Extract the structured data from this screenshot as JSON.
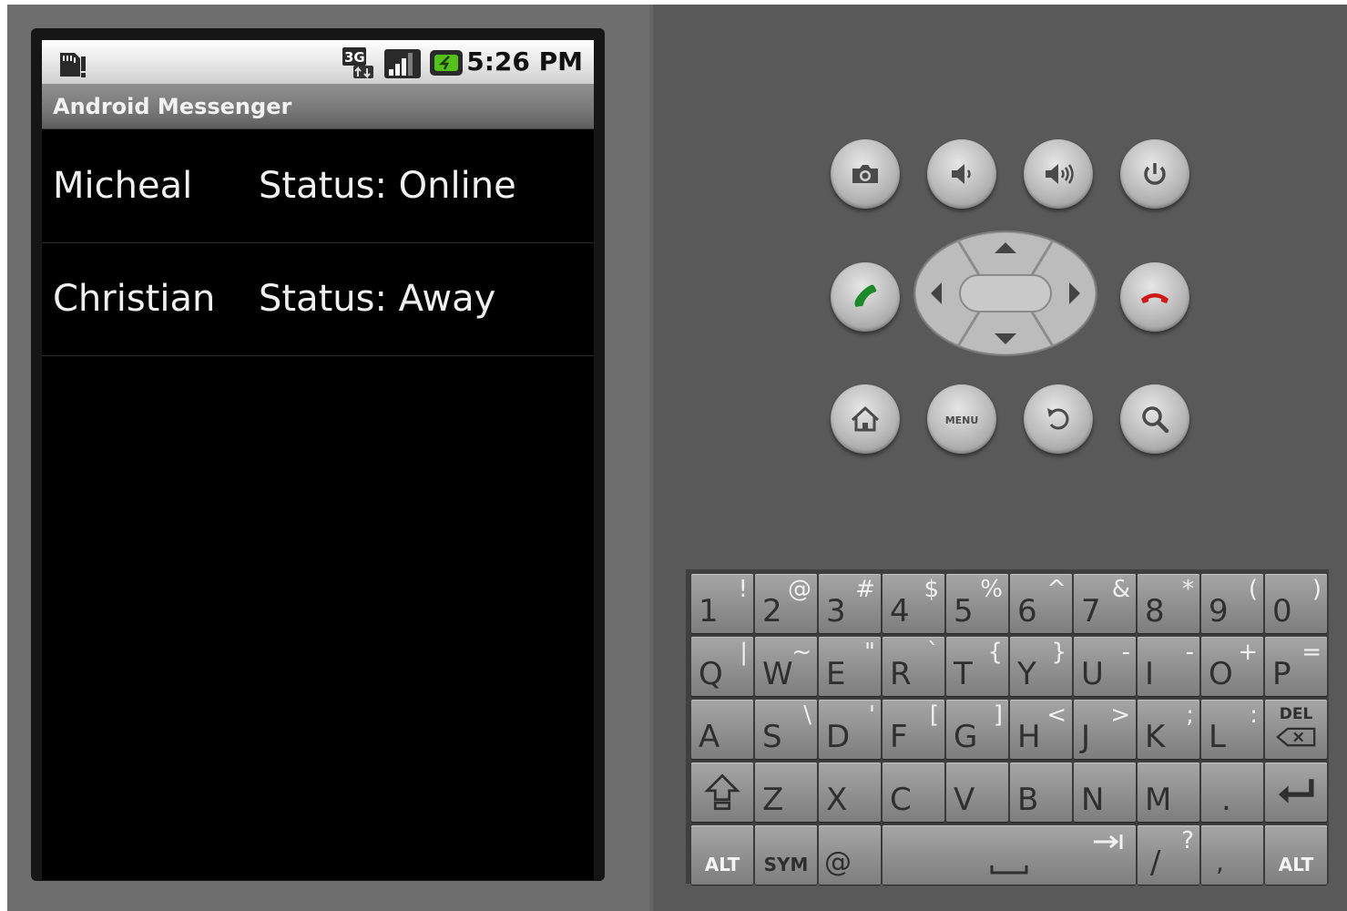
{
  "status_bar": {
    "time": "5:26 PM",
    "icons": [
      "sd-card-icon",
      "3g-icon",
      "signal-icon",
      "battery-charging-icon"
    ]
  },
  "app": {
    "title": "Android Messenger"
  },
  "contacts": [
    {
      "name": "Micheal",
      "status": "Status: Online"
    },
    {
      "name": "Christian",
      "status": "Status: Away"
    }
  ],
  "hardware_buttons": {
    "row1": [
      "camera-icon",
      "volume-down-icon",
      "volume-up-icon",
      "power-icon"
    ],
    "row2": [
      "call-icon",
      "dpad",
      "end-call-icon"
    ],
    "row3": [
      "home-icon",
      "menu-button",
      "back-icon",
      "search-icon"
    ],
    "menu_label": "MENU"
  },
  "keyboard": {
    "rows": [
      [
        [
          "1",
          "!"
        ],
        [
          "2",
          "@"
        ],
        [
          "3",
          "#"
        ],
        [
          "4",
          "$"
        ],
        [
          "5",
          "%"
        ],
        [
          "6",
          "^"
        ],
        [
          "7",
          "&"
        ],
        [
          "8",
          "*"
        ],
        [
          "9",
          "("
        ],
        [
          "0",
          ")"
        ]
      ],
      [
        [
          "Q",
          "|"
        ],
        [
          "W",
          "~"
        ],
        [
          "E",
          "\""
        ],
        [
          "R",
          "`"
        ],
        [
          "T",
          "{"
        ],
        [
          "Y",
          "}"
        ],
        [
          "U",
          "-"
        ],
        [
          "I",
          "-"
        ],
        [
          "O",
          "+"
        ],
        [
          "P",
          "="
        ]
      ],
      [
        [
          "A",
          ""
        ],
        [
          "S",
          "\\"
        ],
        [
          "D",
          "'"
        ],
        [
          "F",
          "["
        ],
        [
          "G",
          "]"
        ],
        [
          "H",
          "<"
        ],
        [
          "J",
          ">"
        ],
        [
          "K",
          ";"
        ],
        [
          "L",
          ":"
        ]
      ],
      [
        [
          "Z",
          ""
        ],
        [
          "X",
          ""
        ],
        [
          "C",
          ""
        ],
        [
          "V",
          ""
        ],
        [
          "B",
          ""
        ],
        [
          "N",
          ""
        ],
        [
          "M",
          ""
        ],
        [
          ".",
          ""
        ]
      ]
    ],
    "del_label": "DEL",
    "alt_label": "ALT",
    "sym_label": "SYM",
    "at_label": "@",
    "slash_key": [
      "/",
      "?"
    ],
    "comma_key": ","
  },
  "colors": {
    "emulator_bg": "#595959",
    "screen_bg": "#000000",
    "key_face": "#9a9a9a",
    "call_green": "#1c8a2a",
    "end_call_red": "#d01818"
  }
}
